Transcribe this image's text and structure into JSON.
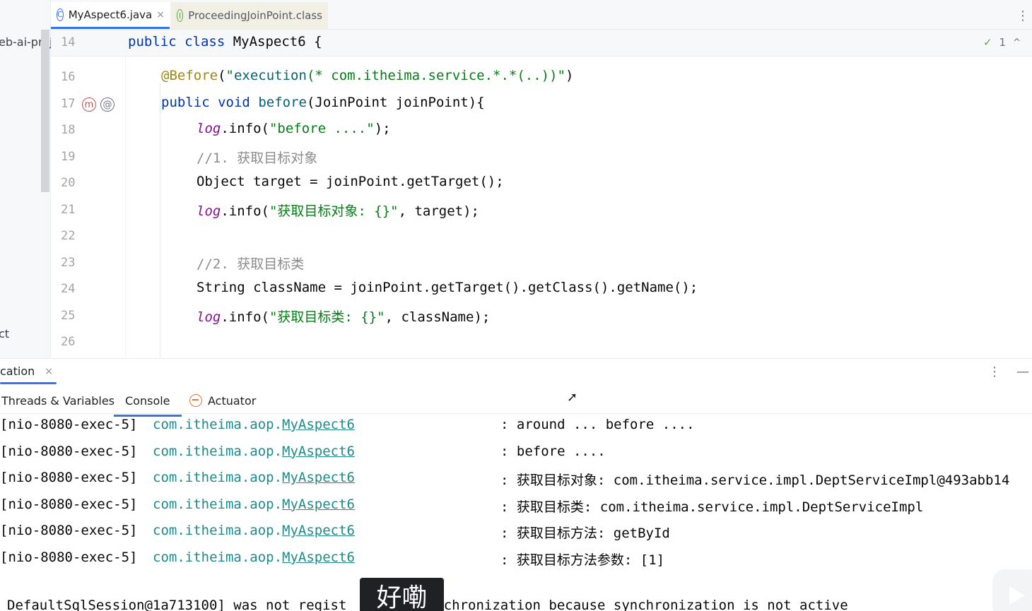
{
  "project_panel": {
    "project_name_fragment": "eb-ai-proj",
    "partial_label": "ct"
  },
  "tabs": [
    {
      "label": "MyAspect6.java",
      "icon": "class-c-icon",
      "close": "×"
    },
    {
      "label": "ProceedingJoinPoint.class",
      "icon": "interface-i-icon"
    }
  ],
  "editor": {
    "sticky_line": {
      "number": "14",
      "text": "public class MyAspect6 {"
    },
    "inspection_count": "1",
    "gutter_icons": {
      "method_marker": "m",
      "annotation_marker": "@"
    },
    "lines": [
      {
        "number": "16",
        "text": "@Before(\"execution(* com.itheima.service.*.*(..))\")"
      },
      {
        "number": "17",
        "text": "public void before(JoinPoint joinPoint){"
      },
      {
        "number": "18",
        "text": "log.info(\"before ....\");"
      },
      {
        "number": "19",
        "text": "//1. 获取目标对象"
      },
      {
        "number": "20",
        "text": "Object target = joinPoint.getTarget();"
      },
      {
        "number": "21",
        "text": "log.info(\"获取目标对象: {}\", target);"
      },
      {
        "number": "22",
        "text": ""
      },
      {
        "number": "23",
        "text": "//2. 获取目标类"
      },
      {
        "number": "24",
        "text": "String className = joinPoint.getTarget().getClass().getName();"
      },
      {
        "number": "25",
        "text": "log.info(\"获取目标类: {}\", className);"
      },
      {
        "number": "26",
        "text": ""
      }
    ]
  },
  "toolwindow": {
    "run_tab": "cation",
    "subtabs": [
      "Threads & Variables",
      "Console",
      "Actuator"
    ],
    "console_lines": [
      {
        "thread": "[nio-8080-exec-5]",
        "logger_pkg": "com.itheima.aop.",
        "logger_cls": "MyAspect6",
        "message": ": around ... before ...."
      },
      {
        "thread": "[nio-8080-exec-5]",
        "logger_pkg": "com.itheima.aop.",
        "logger_cls": "MyAspect6",
        "message": ": before ...."
      },
      {
        "thread": "[nio-8080-exec-5]",
        "logger_pkg": "com.itheima.aop.",
        "logger_cls": "MyAspect6",
        "message": ": 获取目标对象: com.itheima.service.impl.DeptServiceImpl@493abb14"
      },
      {
        "thread": "[nio-8080-exec-5]",
        "logger_pkg": "com.itheima.aop.",
        "logger_cls": "MyAspect6",
        "message": ": 获取目标类: com.itheima.service.impl.DeptServiceImpl"
      },
      {
        "thread": "[nio-8080-exec-5]",
        "logger_pkg": "com.itheima.aop.",
        "logger_cls": "MyAspect6",
        "message": ": 获取目标方法: getById"
      },
      {
        "thread": "[nio-8080-exec-5]",
        "logger_pkg": "com.itheima.aop.",
        "logger_cls": "MyAspect6",
        "message": ": 获取目标方法参数: [1]"
      }
    ],
    "partial_line": "DefaultSqlSession@1a713100] was not regist          ynchronization because synchronization is not active"
  },
  "overlay": {
    "subtitle": "好嘞"
  },
  "colors": {
    "accent": "#3574f0",
    "keyword": "#0033b3",
    "string": "#067d17",
    "logger": "#1f8a8a"
  }
}
